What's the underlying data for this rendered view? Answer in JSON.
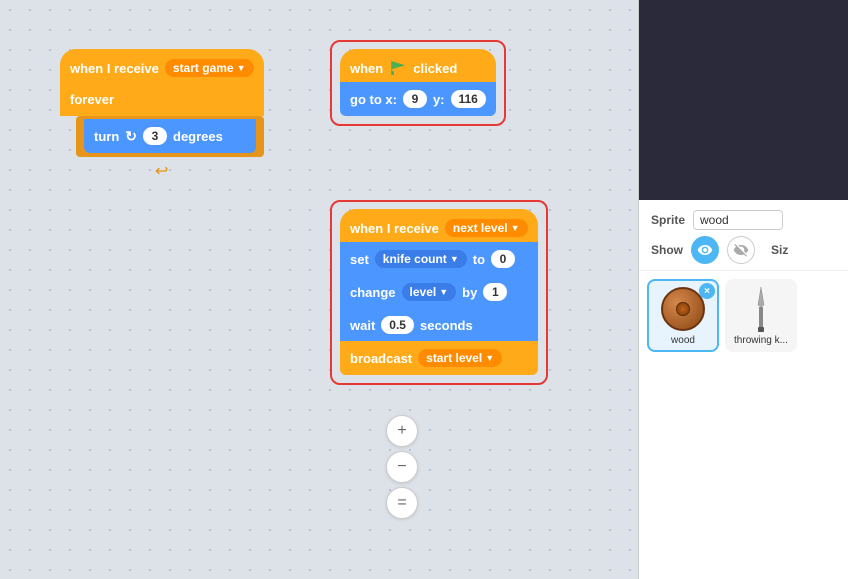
{
  "canvas": {
    "bg": "#dde1e8"
  },
  "block_group_1": {
    "hat_label": "when I receive",
    "hat_dropdown": "start game",
    "forever_label": "forever",
    "turn_label": "turn",
    "turn_value": "3",
    "degrees_label": "degrees"
  },
  "block_group_2": {
    "hat_label": "when",
    "clicked_label": "clicked",
    "goto_label": "go to x:",
    "x_value": "9",
    "y_label": "y:",
    "y_value": "116"
  },
  "block_group_3": {
    "when_receive_label": "when I receive",
    "when_receive_dropdown": "next level",
    "set_label": "set",
    "knife_count_dropdown": "knife count",
    "to_label": "to",
    "knife_count_value": "0",
    "change_label": "change",
    "level_dropdown": "level",
    "by_label": "by",
    "by_value": "1",
    "wait_label": "wait",
    "wait_value": "0.5",
    "seconds_label": "seconds",
    "broadcast_label": "broadcast",
    "start_level_dropdown": "start level"
  },
  "right_panel": {
    "sprite_label": "Sprite",
    "sprite_name": "wood",
    "show_label": "Show",
    "size_label": "Siz",
    "sprites": [
      {
        "id": "wood",
        "label": "wood",
        "selected": true
      },
      {
        "id": "throwing",
        "label": "throwing k...",
        "selected": false
      }
    ]
  },
  "scroll_buttons": [
    {
      "id": "zoom-in",
      "symbol": "+"
    },
    {
      "id": "zoom-out",
      "symbol": "−"
    },
    {
      "id": "fit",
      "symbol": "="
    }
  ]
}
